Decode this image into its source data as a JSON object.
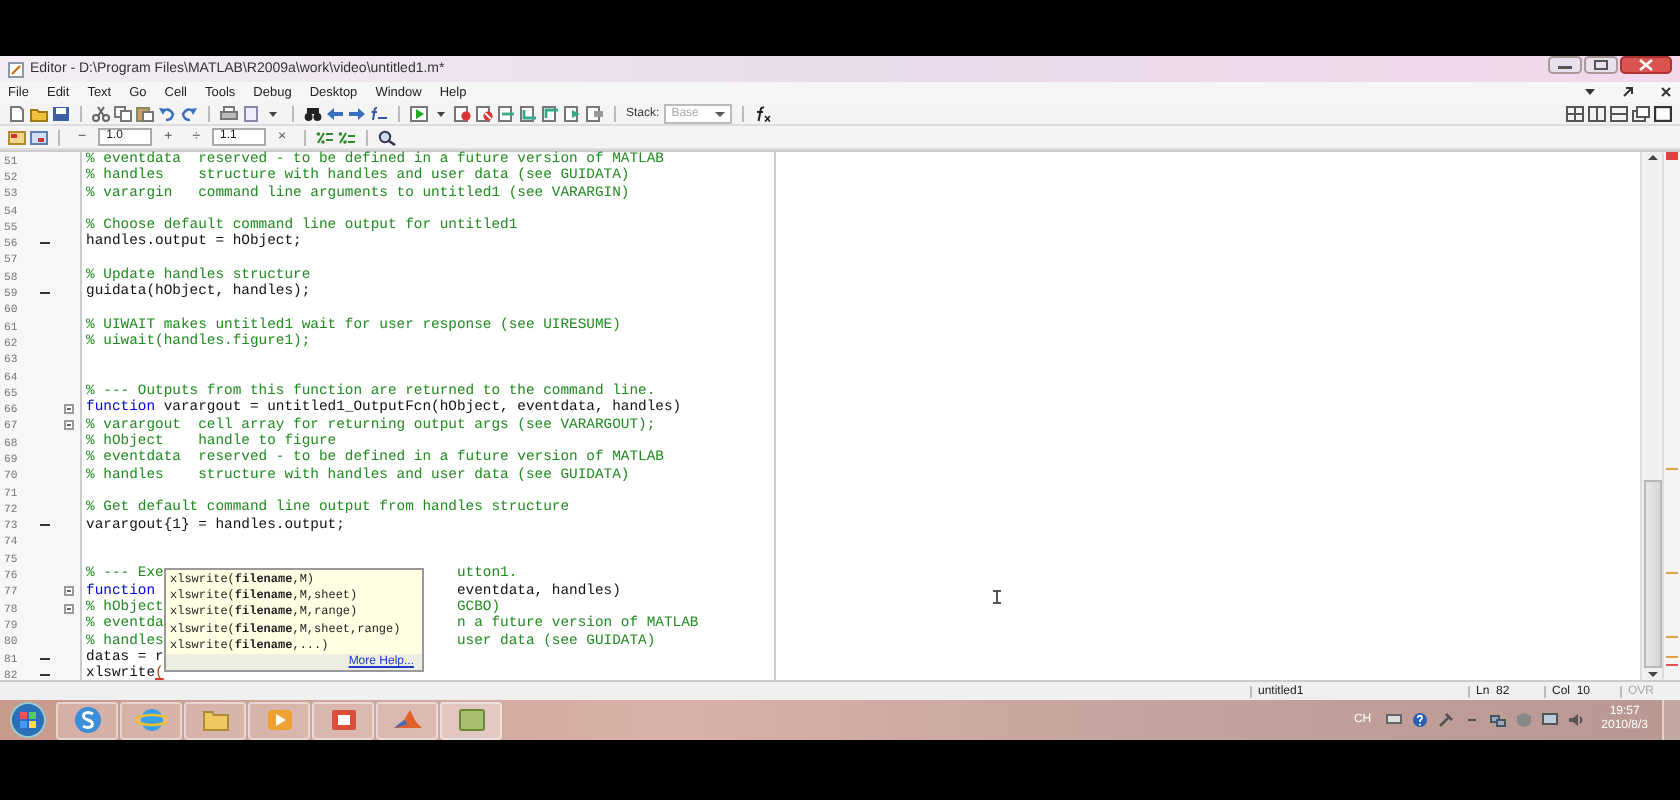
{
  "window": {
    "title": "Editor - D:\\Program Files\\MATLAB\\R2009a\\work\\video\\untitled1.m*"
  },
  "menu": [
    "File",
    "Edit",
    "Text",
    "Go",
    "Cell",
    "Tools",
    "Debug",
    "Desktop",
    "Window",
    "Help"
  ],
  "toolbar": {
    "stack_label": "Stack:",
    "stack_value": "Base"
  },
  "cell_toolbar": {
    "minus": "−",
    "step_a": "1.0",
    "plus": "+",
    "divide": "÷",
    "step_b": "1.1",
    "times": "×"
  },
  "editor": {
    "lines": [
      {
        "number": "51",
        "marker": false,
        "fold": false,
        "code": [
          {
            "kind": "comment",
            "text": "% eventdata  reserved - to be defined in a future version of MATLAB"
          }
        ]
      },
      {
        "number": "52",
        "marker": false,
        "fold": false,
        "code": [
          {
            "kind": "comment",
            "text": "% handles    structure with handles and user data (see GUIDATA)"
          }
        ]
      },
      {
        "number": "53",
        "marker": false,
        "fold": false,
        "code": [
          {
            "kind": "comment",
            "text": "% varargin   command line arguments to untitled1 (see VARARGIN)"
          }
        ]
      },
      {
        "number": "54",
        "marker": false,
        "fold": false
      },
      {
        "number": "55",
        "marker": false,
        "fold": false,
        "code": [
          {
            "kind": "comment",
            "text": "% Choose default command line output for untitled1"
          }
        ]
      },
      {
        "number": "56",
        "marker": true,
        "fold": false,
        "code": [
          {
            "kind": "plain",
            "text": "handles.output = hObject;"
          }
        ]
      },
      {
        "number": "57",
        "marker": false,
        "fold": false
      },
      {
        "number": "58",
        "marker": false,
        "fold": false,
        "code": [
          {
            "kind": "comment",
            "text": "% Update handles structure"
          }
        ]
      },
      {
        "number": "59",
        "marker": true,
        "fold": false,
        "code": [
          {
            "kind": "plain",
            "text": "guidata(hObject, handles);"
          }
        ]
      },
      {
        "number": "60",
        "marker": false,
        "fold": false
      },
      {
        "number": "61",
        "marker": false,
        "fold": false,
        "code": [
          {
            "kind": "comment",
            "text": "% UIWAIT makes untitled1 wait for user response (see UIRESUME)"
          }
        ]
      },
      {
        "number": "62",
        "marker": false,
        "fold": false,
        "code": [
          {
            "kind": "comment",
            "text": "% uiwait(handles.figure1);"
          }
        ]
      },
      {
        "number": "63",
        "marker": false,
        "fold": false
      },
      {
        "number": "64",
        "marker": false,
        "fold": false
      },
      {
        "number": "65",
        "marker": false,
        "fold": false,
        "code": [
          {
            "kind": "comment",
            "text": "% --- Outputs from this function are returned to the command line."
          }
        ]
      },
      {
        "number": "66",
        "marker": false,
        "fold": true,
        "code": [
          {
            "kind": "keyword",
            "text": "function"
          },
          {
            "kind": "plain",
            "text": " varargout = untitled1_OutputFcn(hObject, eventdata, handles)"
          }
        ]
      },
      {
        "number": "67",
        "marker": false,
        "fold": true,
        "code": [
          {
            "kind": "comment",
            "text": "% varargout  cell array for returning output args (see VARARGOUT);"
          }
        ]
      },
      {
        "number": "68",
        "marker": false,
        "fold": false,
        "code": [
          {
            "kind": "comment",
            "text": "% hObject    handle to figure"
          }
        ]
      },
      {
        "number": "69",
        "marker": false,
        "fold": false,
        "code": [
          {
            "kind": "comment",
            "text": "% eventdata  reserved - to be defined in a future version of MATLAB"
          }
        ]
      },
      {
        "number": "70",
        "marker": false,
        "fold": false,
        "code": [
          {
            "kind": "comment",
            "text": "% handles    structure with handles and user data (see GUIDATA)"
          }
        ]
      },
      {
        "number": "71",
        "marker": false,
        "fold": false
      },
      {
        "number": "72",
        "marker": false,
        "fold": false,
        "code": [
          {
            "kind": "comment",
            "text": "% Get default command line output from handles structure"
          }
        ]
      },
      {
        "number": "73",
        "marker": true,
        "fold": false,
        "code": [
          {
            "kind": "plain",
            "text": "varargout{1} = handles.output;"
          }
        ]
      },
      {
        "number": "74",
        "marker": false,
        "fold": false
      },
      {
        "number": "75",
        "marker": false,
        "fold": false
      },
      {
        "number": "76",
        "marker": false,
        "fold": false,
        "code": [
          {
            "kind": "comment",
            "text": "% --- Exe"
          }
        ],
        "after_popup": [
          {
            "kind": "comment",
            "text": "utton1."
          }
        ]
      },
      {
        "number": "77",
        "marker": false,
        "fold": true,
        "code": [
          {
            "kind": "keyword",
            "text": "function"
          }
        ],
        "after_popup": [
          {
            "kind": "plain",
            "text": "eventdata, handles)"
          }
        ]
      },
      {
        "number": "78",
        "marker": false,
        "fold": true,
        "code": [
          {
            "kind": "comment",
            "text": "% hObject"
          }
        ],
        "after_popup": [
          {
            "kind": "comment",
            "text": "GCBO)"
          }
        ]
      },
      {
        "number": "79",
        "marker": false,
        "fold": false,
        "code": [
          {
            "kind": "comment",
            "text": "% eventda"
          }
        ],
        "after_popup": [
          {
            "kind": "comment",
            "text": "n a future version of MATLAB"
          }
        ]
      },
      {
        "number": "80",
        "marker": false,
        "fold": false,
        "code": [
          {
            "kind": "comment",
            "text": "% handles"
          }
        ],
        "after_popup": [
          {
            "kind": "comment",
            "text": "user data (see GUIDATA)"
          }
        ]
      },
      {
        "number": "81",
        "marker": true,
        "fold": false,
        "code": [
          {
            "kind": "plain",
            "text": "datas = r"
          }
        ]
      },
      {
        "number": "82",
        "marker": true,
        "fold": false,
        "code": [
          {
            "kind": "plain",
            "text": "xlswrite"
          },
          {
            "kind": "error",
            "text": "("
          }
        ]
      }
    ],
    "popup": {
      "items": [
        "xlswrite(**filename**,M)",
        "xlswrite(**filename**,M,sheet)",
        "xlswrite(**filename**,M,range)",
        "xlswrite(**filename**,M,sheet,range)",
        "xlswrite(**filename**,...)"
      ],
      "link": "More Help..."
    }
  },
  "status_bar": {
    "file": "untitled1",
    "line": "Ln  82",
    "column": "Col  10",
    "mode": {
      "text": "OVR",
      "active": false
    }
  },
  "taskbar": {
    "language": "CH",
    "time": "19:57",
    "date": "2010/8/3"
  }
}
